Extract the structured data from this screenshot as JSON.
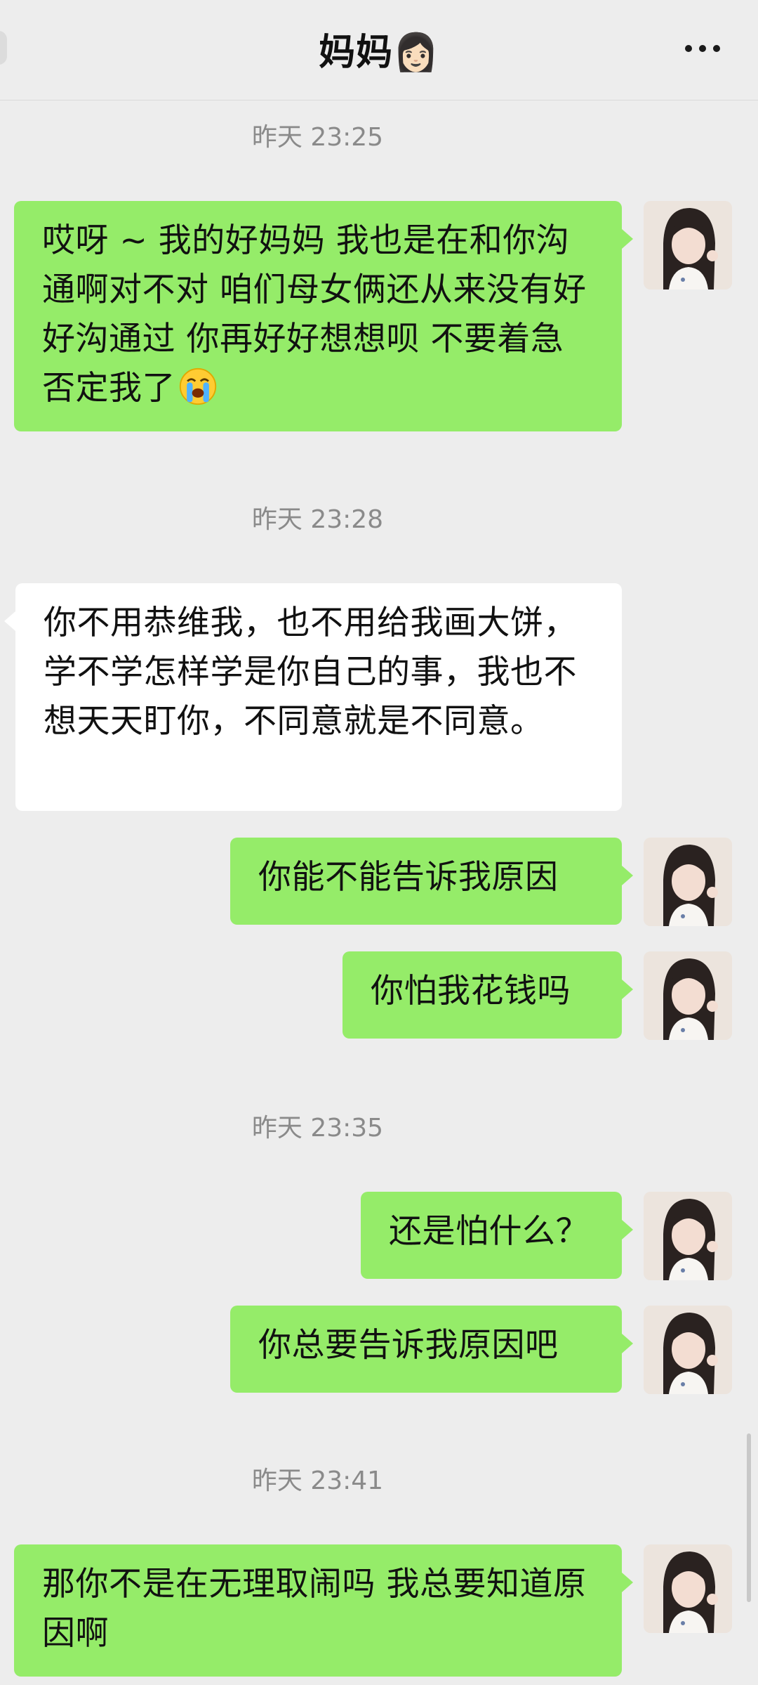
{
  "header": {
    "title": "妈妈👩🏻",
    "more_icon": "more-dots-icon"
  },
  "messages": [
    {
      "type": "time",
      "text": "昨天 23:25"
    },
    {
      "type": "sent",
      "text": "哎呀 ~ 我的好妈妈 我也是在和你沟通啊对不对 咱们母女俩还从来没有好好沟通过 你再好好想想呗 不要着急否定我了",
      "emoji": "loudly-crying-face"
    },
    {
      "type": "time",
      "text": "昨天 23:28"
    },
    {
      "type": "received",
      "text": "你不用恭维我，也不用给我画大饼，学不学怎样学是你自己的事，我也不想天天盯你，不同意就是不同意。"
    },
    {
      "type": "sent",
      "text": "你能不能告诉我原因"
    },
    {
      "type": "sent",
      "text": "你怕我花钱吗"
    },
    {
      "type": "time",
      "text": "昨天 23:35"
    },
    {
      "type": "sent",
      "text": "还是怕什么？"
    },
    {
      "type": "sent",
      "text": "你总要告诉我原因吧"
    },
    {
      "type": "time",
      "text": "昨天 23:41"
    },
    {
      "type": "sent",
      "text": "那你不是在无理取闹吗 我总要知道原因啊"
    }
  ],
  "colors": {
    "background": "#ededed",
    "sent_bubble": "#95ec69",
    "received_bubble": "#ffffff",
    "timestamp": "#8a8a8a"
  }
}
